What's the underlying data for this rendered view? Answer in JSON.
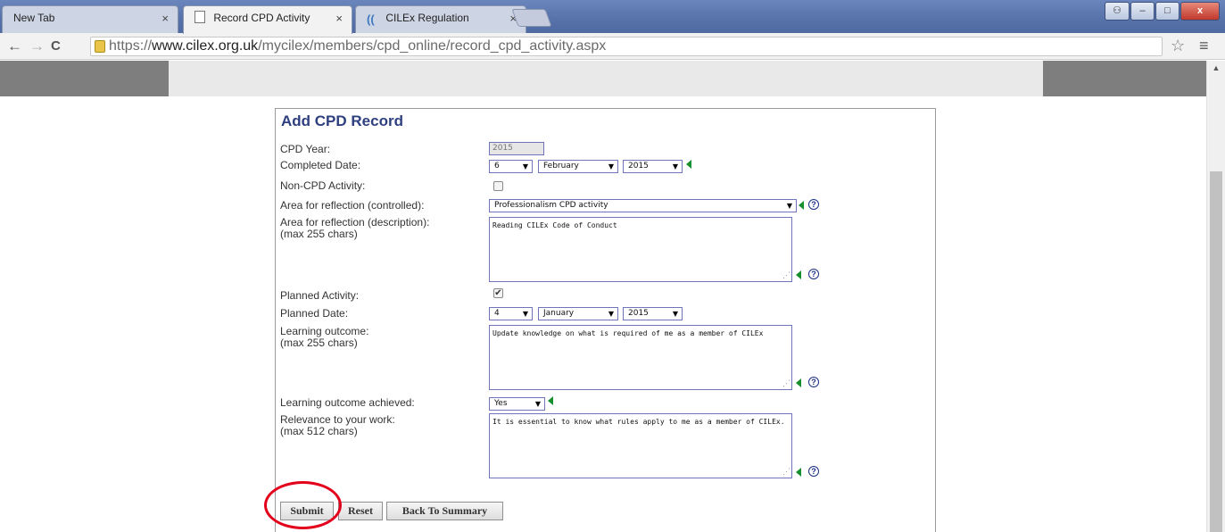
{
  "browser": {
    "tabs": [
      {
        "label": "New Tab"
      },
      {
        "label": "Record CPD Activity"
      },
      {
        "label": "CILEx Regulation"
      }
    ],
    "tab_close": "×",
    "url_prefix": "https://",
    "url_domain": "www.cilex.org.uk",
    "url_path": "/mycilex/members/cpd_online/record_cpd_activity.aspx",
    "window_controls": {
      "minimize": "–",
      "maximize": "□",
      "close": "x"
    },
    "nav": {
      "back": "←",
      "forward": "→",
      "reload": "C"
    },
    "star": "☆",
    "menu": "≡"
  },
  "form": {
    "title": "Add CPD Record",
    "cpd_year": {
      "label": "CPD Year:",
      "value": "2015"
    },
    "completed_date": {
      "label": "Completed Date:",
      "day": "6",
      "month": "February",
      "year": "2015"
    },
    "non_cpd": {
      "label": "Non-CPD Activity:",
      "checked": false
    },
    "area_controlled": {
      "label": "Area for reflection (controlled):",
      "value": "Professionalism CPD activity"
    },
    "area_description": {
      "label": "Area for reflection (description):",
      "sub": "(max 255 chars)",
      "value": "Reading CILEx Code of Conduct"
    },
    "planned_activity": {
      "label": "Planned Activity:",
      "checked": true,
      "mark": "✔"
    },
    "planned_date": {
      "label": "Planned Date:",
      "day": "4",
      "month": "January",
      "year": "2015"
    },
    "learning_outcome": {
      "label": "Learning outcome:",
      "sub": "(max 255 chars)",
      "value": "Update knowledge on what is required of me as a member of CILEx"
    },
    "outcome_achieved": {
      "label": "Learning outcome achieved:",
      "value": "Yes"
    },
    "relevance": {
      "label": "Relevance to your work:",
      "sub": "(max 512 chars)",
      "value": "It is essential to know what rules apply to me as a member of CILEx."
    },
    "buttons": {
      "submit": "Submit",
      "reset": "Reset",
      "back": "Back To Summary"
    },
    "help_glyph": "?",
    "dropdown_arrow": "▼"
  },
  "colors": {
    "accent": "#2e3f7f",
    "highlight": "#e3001b",
    "indicator": "#178f2e"
  }
}
